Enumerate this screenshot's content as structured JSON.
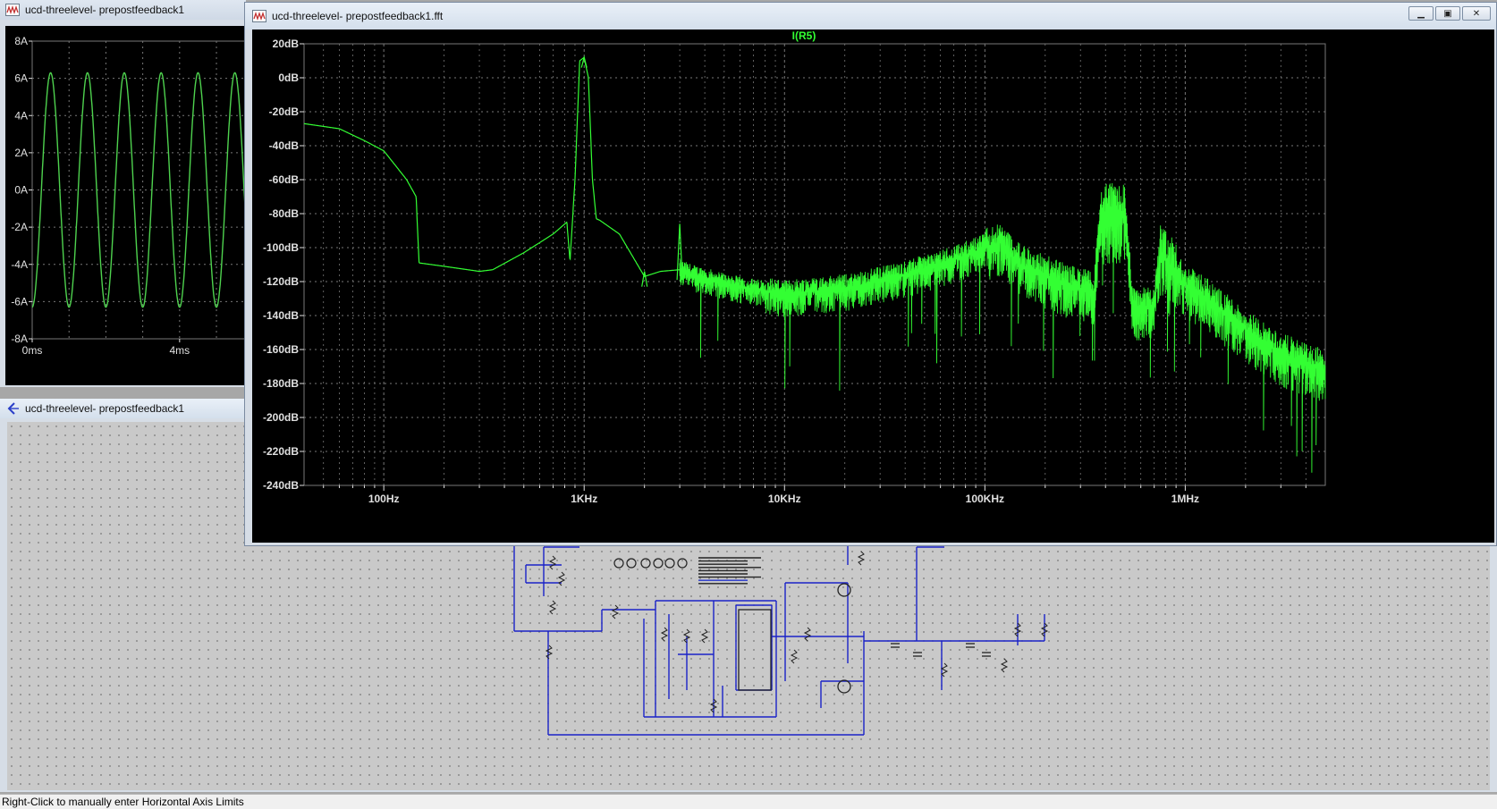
{
  "status_bar": {
    "text": "Right-Click to manually enter Horizontal Axis Limits"
  },
  "windows": {
    "time_plot": {
      "title": "ucd-threelevel- prepostfeedback1",
      "y_ticks": [
        "8A",
        "6A",
        "4A",
        "2A",
        "0A",
        "-2A",
        "-4A",
        "-6A",
        "-8A"
      ],
      "x_ticks": [
        "0ms",
        "4ms"
      ]
    },
    "schematic": {
      "title": "ucd-threelevel- prepostfeedback1"
    },
    "fft_plot": {
      "title": "ucd-threelevel- prepostfeedback1.fft",
      "controls": {
        "minimize": "▁",
        "restore": "▣",
        "close": "✕"
      }
    }
  },
  "colors": {
    "trace": "#33ff33",
    "trace_time": "#4ed24e",
    "plot_bg": "#000000",
    "grid": "#777777",
    "axis_label": "#e0e0e0",
    "wire": "#1a22c8",
    "desktop": "#a7a7a7"
  },
  "chart_data": [
    {
      "type": "line",
      "title": "",
      "xlabel": "",
      "ylabel": "",
      "x_ticks": [
        "0ms",
        "4ms"
      ],
      "y_ticks": [
        "8A",
        "6A",
        "4A",
        "2A",
        "0A",
        "-2A",
        "-4A",
        "-6A",
        "-8A"
      ],
      "xlim_ms": [
        0,
        5.8
      ],
      "ylim": [
        -8,
        8
      ],
      "grid": true,
      "series": [
        {
          "name": "",
          "amplitude_A": 6.3,
          "frequency_hz": 1000,
          "phase_deg": -90
        }
      ]
    },
    {
      "type": "line",
      "title": "I(R5)",
      "xlabel": "",
      "ylabel": "",
      "x_scale": "log",
      "x_ticks": [
        "100Hz",
        "1KHz",
        "10KHz",
        "100KHz",
        "1MHz"
      ],
      "y_ticks": [
        "20dB",
        "0dB",
        "-20dB",
        "-40dB",
        "-60dB",
        "-80dB",
        "-100dB",
        "-120dB",
        "-140dB",
        "-160dB",
        "-180dB",
        "-200dB",
        "-220dB",
        "-240dB"
      ],
      "xlim_hz": [
        40,
        5000000
      ],
      "ylim_db": [
        -240,
        20
      ],
      "grid": true,
      "legend": "top-center",
      "series": [
        {
          "name": "I(R5)",
          "envelope_db": [
            [
              40,
              -27
            ],
            [
              60,
              -30
            ],
            [
              80,
              -37
            ],
            [
              100,
              -43
            ],
            [
              115,
              -52
            ],
            [
              130,
              -60
            ],
            [
              145,
              -70
            ],
            [
              150,
              -109
            ],
            [
              200,
              -111
            ],
            [
              300,
              -114
            ],
            [
              350,
              -113
            ],
            [
              500,
              -103
            ],
            [
              700,
              -92
            ],
            [
              820,
              -85
            ],
            [
              850,
              -108
            ],
            [
              900,
              -60
            ],
            [
              950,
              10
            ],
            [
              1000,
              12
            ],
            [
              1050,
              0
            ],
            [
              1100,
              -60
            ],
            [
              1150,
              -83
            ],
            [
              1200,
              -84
            ],
            [
              1500,
              -92
            ],
            [
              2000,
              -117
            ],
            [
              2400,
              -114
            ],
            [
              3000,
              -113
            ],
            [
              3500,
              -116
            ],
            [
              6000,
              -123
            ],
            [
              10000,
              -127
            ],
            [
              20000,
              -124
            ],
            [
              40000,
              -116
            ],
            [
              70000,
              -107
            ],
            [
              100000,
              -100
            ],
            [
              120000,
              -97
            ],
            [
              150000,
              -110
            ],
            [
              250000,
              -121
            ],
            [
              350000,
              -126
            ],
            [
              380000,
              -80
            ],
            [
              500000,
              -80
            ],
            [
              550000,
              -136
            ],
            [
              700000,
              -134
            ],
            [
              750000,
              -104
            ],
            [
              900000,
              -115
            ],
            [
              1000000,
              -122
            ],
            [
              1200000,
              -127
            ],
            [
              2000000,
              -148
            ],
            [
              3000000,
              -162
            ],
            [
              5000000,
              -172
            ]
          ],
          "peaks_db": [
            [
              1000,
              12
            ],
            [
              2000,
              -114
            ],
            [
              3000,
              -86
            ]
          ]
        }
      ]
    }
  ]
}
